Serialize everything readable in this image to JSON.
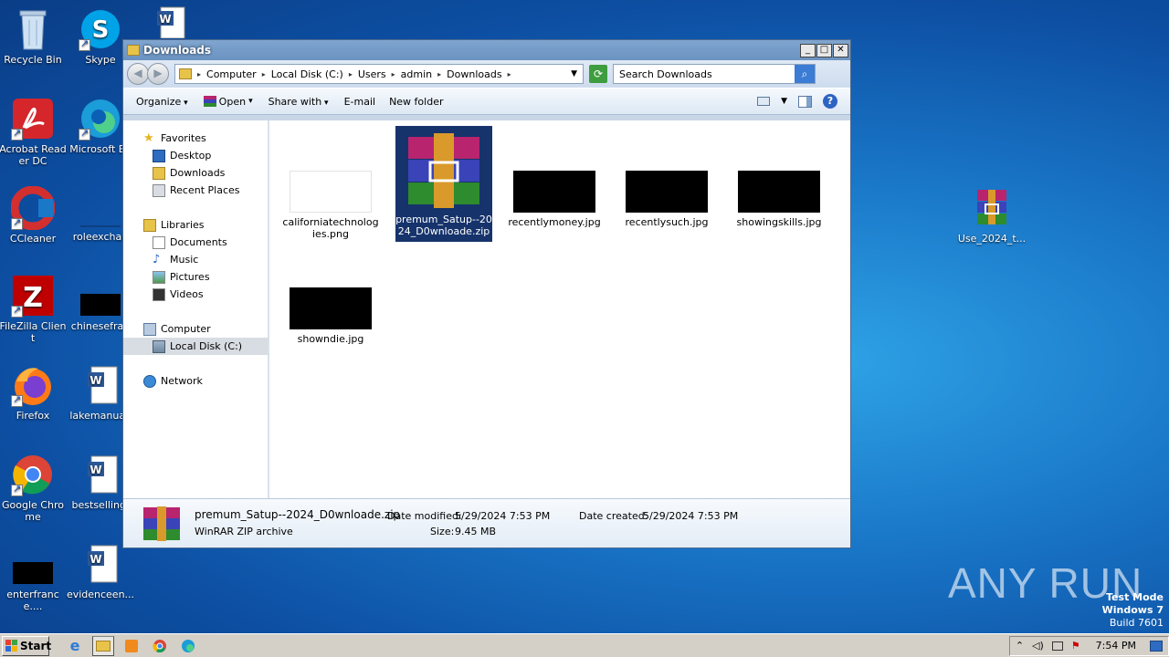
{
  "desktop": {
    "icons": [
      {
        "label": "Recycle Bin"
      },
      {
        "label": "Skype"
      },
      {
        "label": "Acrobat Reader DC"
      },
      {
        "label": "Microsoft Ed"
      },
      {
        "label": "CCleaner"
      },
      {
        "label": "roleexchan"
      },
      {
        "label": "FileZilla Client"
      },
      {
        "label": "chinesefran"
      },
      {
        "label": "Firefox"
      },
      {
        "label": "lakemanual."
      },
      {
        "label": "Google Chrome"
      },
      {
        "label": "bestselling."
      },
      {
        "label": "enterfrance...."
      },
      {
        "label": "evidenceen..."
      },
      {
        "label": "Use_2024_t..."
      }
    ]
  },
  "window": {
    "title": "Downloads",
    "caption_buttons": [
      "_",
      "□",
      "✕"
    ],
    "breadcrumb": [
      "Computer",
      "Local Disk (C:)",
      "Users",
      "admin",
      "Downloads"
    ],
    "search_placeholder": "Search Downloads",
    "toolbar": {
      "organize": "Organize",
      "open": "Open",
      "share_with": "Share with",
      "email": "E-mail",
      "new_folder": "New folder"
    },
    "nav": {
      "favorites": "Favorites",
      "desktop": "Desktop",
      "downloads": "Downloads",
      "recent_places": "Recent Places",
      "libraries": "Libraries",
      "documents": "Documents",
      "music": "Music",
      "pictures": "Pictures",
      "videos": "Videos",
      "computer": "Computer",
      "local_disk": "Local Disk (C:)",
      "network": "Network"
    },
    "files": [
      {
        "name": "californiatechnologies.png",
        "selected": false
      },
      {
        "name": "premum_Satup--2024_D0wnloade.zip",
        "selected": true
      },
      {
        "name": "recentlymoney.jpg",
        "selected": false
      },
      {
        "name": "recentlysuch.jpg",
        "selected": false
      },
      {
        "name": "showingskills.jpg",
        "selected": false
      },
      {
        "name": "showndie.jpg",
        "selected": false
      }
    ],
    "details": {
      "filename": "premum_Satup--2024_D0wnloade.zip",
      "type": "WinRAR ZIP archive",
      "modified_label": "Date modified:",
      "modified": "5/29/2024 7:53 PM",
      "size_label": "Size:",
      "size": "9.45 MB",
      "created_label": "Date created:",
      "created": "5/29/2024 7:53 PM"
    }
  },
  "taskbar": {
    "start": "Start",
    "clock": "7:54 PM"
  },
  "watermark": {
    "line1": "Test Mode",
    "line2": "Windows 7",
    "line3": "Build 7601",
    "brand": "ANY RUN"
  },
  "colors": {
    "selection": "#16336b",
    "title_bar": "#7fa5cf"
  }
}
